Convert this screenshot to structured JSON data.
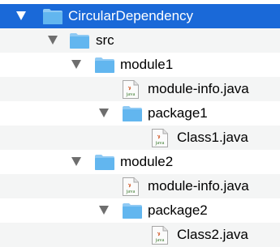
{
  "tree": {
    "root": {
      "label": "CircularDependency",
      "icon": "folder-icon",
      "expanded": true,
      "selected": true
    },
    "src": {
      "label": "src",
      "icon": "folder-icon",
      "expanded": true
    },
    "module1": {
      "label": "module1",
      "icon": "folder-icon",
      "expanded": true,
      "module_info": {
        "label": "module-info.java",
        "icon": "java-file-icon",
        "badge": "java"
      },
      "package": {
        "label": "package1",
        "icon": "folder-icon",
        "expanded": true
      },
      "class": {
        "label": "Class1.java",
        "icon": "java-file-icon",
        "badge": "java"
      }
    },
    "module2": {
      "label": "module2",
      "icon": "folder-icon",
      "expanded": true,
      "module_info": {
        "label": "module-info.java",
        "icon": "java-file-icon",
        "badge": "java"
      },
      "package": {
        "label": "package2",
        "icon": "folder-icon",
        "expanded": true
      },
      "class": {
        "label": "Class2.java",
        "icon": "java-file-icon",
        "badge": "java"
      }
    }
  },
  "colors": {
    "selection": "#1a69d8",
    "folder": "#62b6ef",
    "folder_tab": "#8fcaf4",
    "disclosure": "#6e6e6e",
    "java_badge": "#3a7a2c"
  }
}
